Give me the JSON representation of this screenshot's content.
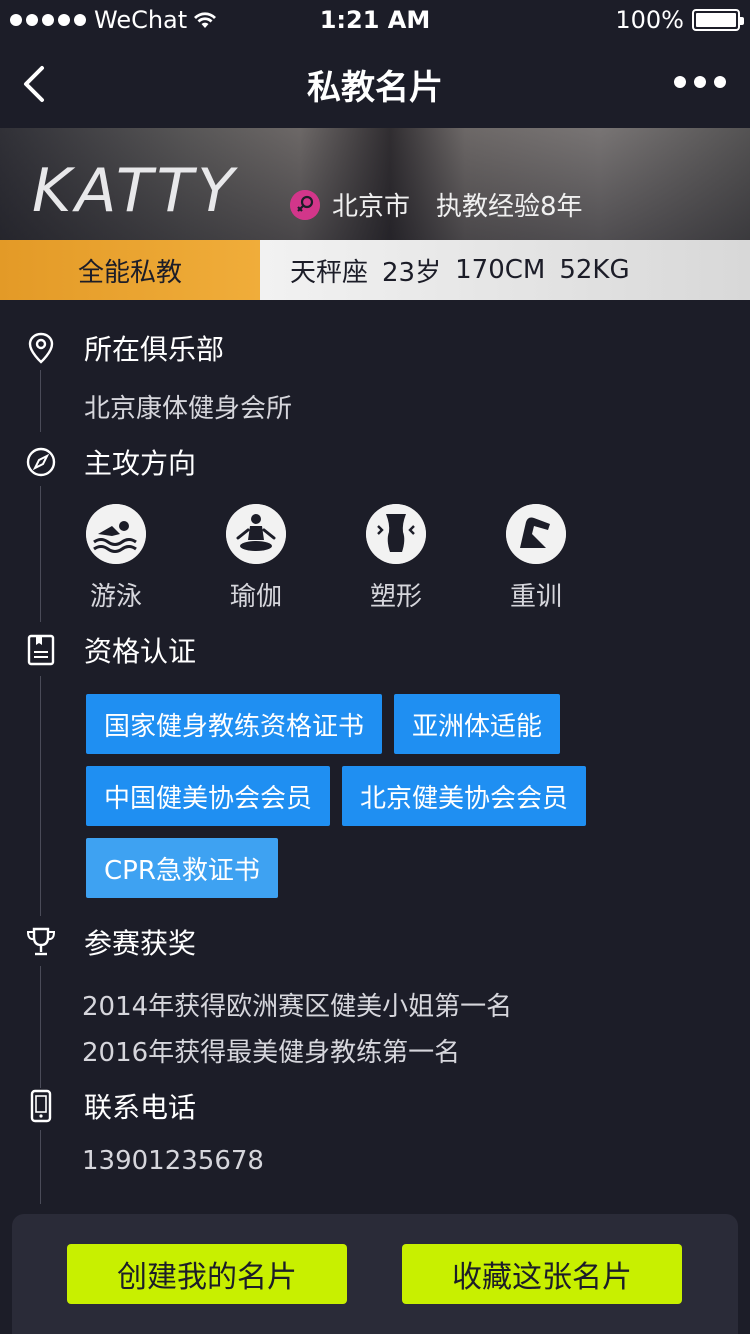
{
  "status_bar": {
    "carrier": "WeChat",
    "time": "1:21 AM",
    "battery": "100%"
  },
  "nav": {
    "title": "私教名片"
  },
  "profile": {
    "name": "KATTY",
    "city": "北京市",
    "experience": "执教经验8年",
    "level": "全能私教",
    "zodiac": "天秤座",
    "age": "23岁",
    "height": "170CM",
    "weight": "52KG"
  },
  "sections": {
    "club": {
      "title": "所在俱乐部",
      "value": "北京康体健身会所"
    },
    "focus": {
      "title": "主攻方向",
      "skills": [
        {
          "label": "游泳",
          "icon": "swimming-icon"
        },
        {
          "label": "瑜伽",
          "icon": "yoga-icon"
        },
        {
          "label": "塑形",
          "icon": "body-shaping-icon"
        },
        {
          "label": "重训",
          "icon": "weight-training-icon"
        }
      ]
    },
    "certs": {
      "title": "资格认证",
      "items": [
        "国家健身教练资格证书",
        "亚洲体适能",
        "中国健美协会会员",
        "北京健美协会会员",
        "CPR急救证书"
      ]
    },
    "awards": {
      "title": "参赛获奖",
      "items": [
        "2014年获得欧洲赛区健美小姐第一名",
        "2016年获得最美健身教练第一名"
      ]
    },
    "phone": {
      "title": "联系电话",
      "value": "13901235678"
    }
  },
  "actions": {
    "create": "创建我的名片",
    "save": "收藏这张名片"
  },
  "colors": {
    "background": "#1c1d28",
    "accent_orange": "#e39a27",
    "cert_blue": "#1f8ff2",
    "button_lime": "#c8f000",
    "gender_pink": "#d2368a"
  }
}
